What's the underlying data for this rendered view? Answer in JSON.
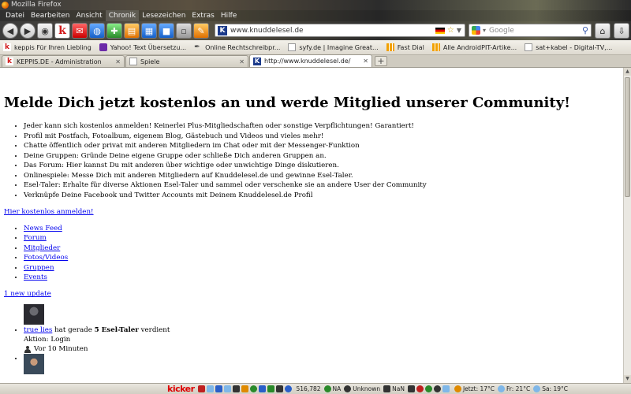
{
  "window": {
    "title": "Mozilla Firefox"
  },
  "menubar": {
    "items": [
      "Datei",
      "Bearbeiten",
      "Ansicht",
      "Chronik",
      "Lesezeichen",
      "Extras",
      "Hilfe"
    ]
  },
  "navbar": {
    "url": "www.knuddelesel.de",
    "search_placeholder": "Google"
  },
  "bookmarks": [
    {
      "label": "keppis Für Ihren Liebling",
      "icon": "k-icon"
    },
    {
      "label": "Yahoo! Text Übersetzu...",
      "icon": "yahoo-icon"
    },
    {
      "label": "Online Rechtschreibpr...",
      "icon": "pen-icon"
    },
    {
      "label": "syfy.de | Imagine Great...",
      "icon": "page-icon"
    },
    {
      "label": "Fast Dial",
      "icon": "grid-icon"
    },
    {
      "label": "Alle AndroidPIT-Artike...",
      "icon": "grid-icon"
    },
    {
      "label": "sat+kabel - Digital-TV,...",
      "icon": "page-icon"
    }
  ],
  "tabs": [
    {
      "label": "KEPPIS.DE - Administration",
      "active": false
    },
    {
      "label": "Spiele",
      "active": false
    },
    {
      "label": "http://www.knuddelesel.de/",
      "active": true
    }
  ],
  "page": {
    "headline": "Melde Dich jetzt kostenlos an und werde Mitglied unserer Community!",
    "features": [
      "Jeder kann sich kostenlos anmelden! Keinerlei Plus-Mitgliedschaften oder sonstige Verpflichtungen! Garantiert!",
      "Profil mit Postfach, Fotoalbum, eigenem Blog, Gästebuch und Videos und vieles mehr!",
      "Chatte öffentlich oder privat mit anderen Mitgliedern im Chat oder mit der Messenger-Funktion",
      "Deine Gruppen: Gründe Deine eigene Gruppe oder schließe Dich anderen Gruppen an.",
      "Das Forum: Hier kannst Du mit anderen über wichtige oder unwichtige Dinge diskutieren.",
      "Onlinespiele: Messe Dich mit anderen Mitgliedern auf Knuddelesel.de und gewinne Esel-Taler.",
      "Esel-Taler: Erhalte für diverse Aktionen Esel-Taler und sammel oder verschenke sie an andere User der Community",
      "Verknüpfe Deine Facebook und Twitter Accounts mit Deinem Knuddelesel.de Profil"
    ],
    "register_link": "Hier kostenlos anmelden!",
    "nav_links": [
      "News Feed",
      "Forum",
      "Mitglieder",
      "Fotos/Videos",
      "Gruppen",
      "Events"
    ],
    "updates_link": "1 new update",
    "feed": [
      {
        "user": "true lies",
        "text_before": " hat gerade ",
        "bold": "5 Esel-Taler",
        "text_after": " verdient",
        "action": "Aktion: Login",
        "time": "Vor 10 Minuten"
      }
    ]
  },
  "statusbar": {
    "brand": "kicker",
    "count": "516,782",
    "na": "NA",
    "unknown": "Unknown",
    "nan": "NaN",
    "weather_now": "Jetzt: 17°C",
    "weather_fri": "Fr: 21°C",
    "weather_sat": "Sa: 19°C"
  }
}
